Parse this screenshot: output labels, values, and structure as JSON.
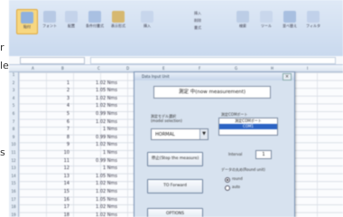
{
  "side_text": [
    "r",
    "le",
    "s"
  ],
  "ribbon": {
    "tabs": [
      "ホーム",
      "挿入",
      "ページ",
      "数式",
      "データ",
      "校閲",
      "表示"
    ],
    "buttons": [
      {
        "label": "貼付"
      },
      {
        "label": "フォント"
      },
      {
        "label": "配置"
      },
      {
        "label": "条件付書式"
      },
      {
        "label": "表示形式"
      },
      {
        "label": "挿入"
      },
      {
        "label": "検索"
      },
      {
        "label": "ツール"
      },
      {
        "label": "並べ替え"
      },
      {
        "label": "フィルタ"
      }
    ],
    "small_items": [
      "挿入",
      "削除",
      "書式"
    ]
  },
  "formula_bar": {
    "name_box": "",
    "content": ""
  },
  "sheet": {
    "columns": [
      "A",
      "B",
      "C",
      "D",
      "E",
      "F",
      "G",
      "H",
      "I"
    ],
    "rows": [
      {
        "n": "1",
        "a": "",
        "b": ""
      },
      {
        "n": "2",
        "a": "1",
        "b": "1.02 Nms"
      },
      {
        "n": "3",
        "a": "2",
        "b": "1.05 Nms"
      },
      {
        "n": "4",
        "a": "3",
        "b": "1.02 Nms"
      },
      {
        "n": "5",
        "a": "4",
        "b": "1.02 Nms"
      },
      {
        "n": "6",
        "a": "5",
        "b": "0.99 Nms"
      },
      {
        "n": "7",
        "a": "6",
        "b": "1.02 Nms"
      },
      {
        "n": "8",
        "a": "7",
        "b": "1 Nms"
      },
      {
        "n": "9",
        "a": "8",
        "b": "0.99 Nms"
      },
      {
        "n": "10",
        "a": "9",
        "b": "1.02 Nms"
      },
      {
        "n": "11",
        "a": "10",
        "b": "1 Nms"
      },
      {
        "n": "12",
        "a": "11",
        "b": "0.99 Nms"
      },
      {
        "n": "13",
        "a": "12",
        "b": "1 Nms"
      },
      {
        "n": "14",
        "a": "13",
        "b": "1.05 Nms"
      },
      {
        "n": "15",
        "a": "14",
        "b": "1.02 Nms"
      },
      {
        "n": "16",
        "a": "15",
        "b": "1.02 Nms"
      },
      {
        "n": "17",
        "a": "16",
        "b": "1.05 Nms"
      },
      {
        "n": "18",
        "a": "17",
        "b": "1.02 Nms"
      },
      {
        "n": "19",
        "a": "18",
        "b": "1.02 Nms"
      }
    ]
  },
  "dialog": {
    "title": "Data Input Unit",
    "close": "×",
    "banner": "測定 中(now measurement)",
    "group_left_label": "測定モデル選択\n(model selection)",
    "model_value": "HORMAL",
    "dropdown_arrow": "▼",
    "group_right_label": "測定COMポート",
    "list_items": [
      "測定COMポート",
      "COM1"
    ],
    "stop_button": "停止(Stop the measure)",
    "interval_label": "Interval",
    "interval_value": "1",
    "round_label": "データの丸め(Round unit)",
    "radio_round": "round",
    "radio_auto": "auto",
    "btn_forward": "TO Forward",
    "btn_bottom": "OPTIONS"
  }
}
